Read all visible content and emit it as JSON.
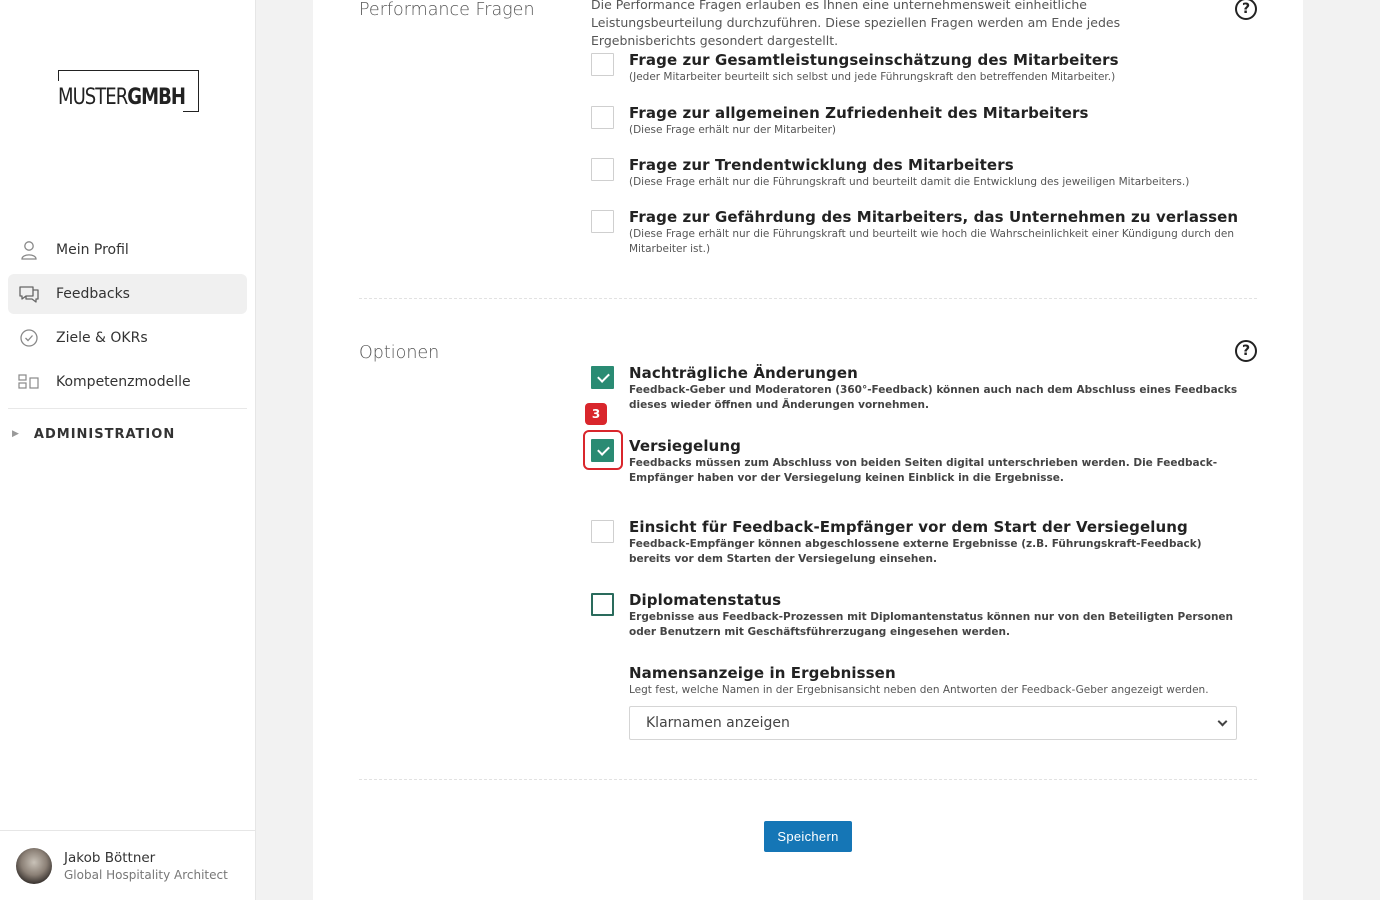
{
  "sidebar": {
    "logo": {
      "light": "MUSTER",
      "bold": "GMBH"
    },
    "items": [
      {
        "label": "Mein Profil",
        "icon": "user-icon",
        "active": false
      },
      {
        "label": "Feedbacks",
        "icon": "chat-icon",
        "active": true
      },
      {
        "label": "Ziele & OKRs",
        "icon": "check-circle-icon",
        "active": false
      },
      {
        "label": "Kompetenzmodelle",
        "icon": "blocks-icon",
        "active": false
      }
    ],
    "admin_label": "ADMINISTRATION",
    "user": {
      "name": "Jakob Böttner",
      "role": "Global Hospitality Architect"
    }
  },
  "performance": {
    "title": "Performance Fragen",
    "intro": "Die Performance Fragen erlauben es Ihnen eine unternehmensweit einheitliche Leistungsbeurteilung durchzuführen. Diese speziellen Fragen werden am Ende jedes Ergebnisberichts gesondert dargestellt.",
    "help_icon": "question-circle-icon",
    "options": [
      {
        "title": "Frage zur Gesamtleistungseinschätzung des Mitarbeiters",
        "desc": "(Jeder Mitarbeiter beurteilt sich selbst und jede Führungskraft den betreffenden Mitarbeiter.)",
        "checked": false
      },
      {
        "title": "Frage zur allgemeinen Zufriedenheit des Mitarbeiters",
        "desc": "(Diese Frage erhält nur der Mitarbeiter)",
        "checked": false
      },
      {
        "title": "Frage zur Trendentwicklung des Mitarbeiters",
        "desc": "(Diese Frage erhält nur die Führungskraft und beurteilt damit die Entwicklung des jeweiligen Mitarbeiters.)",
        "checked": false
      },
      {
        "title": "Frage zur Gefährdung des Mitarbeiters, das Unternehmen zu verlassen",
        "desc": "(Diese Frage erhält nur die Führungskraft und beurteilt wie hoch die Wahrscheinlichkeit einer Kündigung durch den Mitarbeiter ist.)",
        "checked": false
      }
    ]
  },
  "optionen": {
    "title": "Optionen",
    "help_icon": "question-circle-icon",
    "options": [
      {
        "title": "Nachträgliche Änderungen",
        "desc": "Feedback-Geber und Moderatoren (360°-Feedback) können auch nach dem Abschluss eines Feedbacks dieses wieder öffnen und Änderungen vornehmen.",
        "checked": true
      },
      {
        "title": "Versiegelung",
        "desc": "Feedbacks müssen zum Abschluss von beiden Seiten digital unterschrieben werden. Die Feedback-Empfänger haben vor der Versiegelung keinen Einblick in die Ergebnisse.",
        "checked": true
      },
      {
        "title": "Einsicht für Feedback-Empfänger vor dem Start der Versiegelung",
        "desc": "Feedback-Empfänger können abgeschlossene externe Ergebnisse (z.B. Führungskraft-Feedback) bereits vor dem Starten der Versiegelung einsehen.",
        "checked": false
      },
      {
        "title": "Diplomatenstatus",
        "desc": "Ergebnisse aus Feedback-Prozessen mit Diplomantenstatus können nur von den Beteiligten Personen oder Benutzern mit Geschäftsführerzugang eingesehen werden.",
        "checked": false
      }
    ],
    "name_display": {
      "title": "Namensanzeige in Ergebnissen",
      "desc": "Legt fest, welche Namen in der Ergebnisansicht neben den Antworten der Feedback-Geber angezeigt werden.",
      "selected": "Klarnamen anzeigen"
    }
  },
  "annotation": {
    "badge": "3"
  },
  "save_label": "Speichern",
  "colors": {
    "accent": "#2a8b73",
    "primary_button": "#1576b6",
    "marker": "#d9262c"
  }
}
